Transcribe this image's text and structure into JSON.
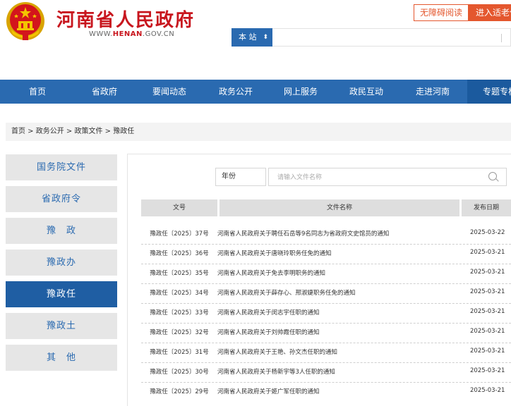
{
  "header": {
    "site_title": "河南省人民政府",
    "site_url_prefix": "WWW.",
    "site_url_highlight": "HENAN",
    "site_url_suffix": ".GOV.CN",
    "accessibility_label": "无障碍阅读",
    "elder_mode_label": "进入适老化",
    "search_scope_label": "本 站",
    "brand_color": "#c8161e",
    "accent_color": "#2a6ab0"
  },
  "nav": {
    "items": [
      {
        "label": "首页"
      },
      {
        "label": "省政府"
      },
      {
        "label": "要闻动态"
      },
      {
        "label": "政务公开"
      },
      {
        "label": "网上服务"
      },
      {
        "label": "政民互动"
      },
      {
        "label": "走进河南"
      },
      {
        "label": "专题专栏"
      }
    ],
    "active_index": 7
  },
  "breadcrumb": "首页 > 政务公开 > 政策文件 > 豫政任",
  "sidebar": {
    "items": [
      {
        "label": "国务院文件"
      },
      {
        "label": "省政府令"
      },
      {
        "label": "豫　政"
      },
      {
        "label": "豫政办"
      },
      {
        "label": "豫政任"
      },
      {
        "label": "豫政土"
      },
      {
        "label": "其　他"
      }
    ],
    "active_index": 4
  },
  "filter": {
    "year_label": "年份",
    "name_placeholder": "请输入文件名称"
  },
  "table": {
    "headers": {
      "no": "文号",
      "title": "文件名称",
      "date": "发布日期"
    },
    "rows": [
      {
        "no": "豫政任〔2025〕37号",
        "title": "河南省人民政府关于聘任石岳等9名同志为省政府文史馆员的通知",
        "date": "2025-03-22"
      },
      {
        "no": "豫政任〔2025〕36号",
        "title": "河南省人民政府关于唐晓玲职务任免的通知",
        "date": "2025-03-21"
      },
      {
        "no": "豫政任〔2025〕35号",
        "title": "河南省人民政府关于免去李明职务的通知",
        "date": "2025-03-21"
      },
      {
        "no": "豫政任〔2025〕34号",
        "title": "河南省人民政府关于薛存心、邢淑婕职务任免的通知",
        "date": "2025-03-21"
      },
      {
        "no": "豫政任〔2025〕33号",
        "title": "河南省人民政府关于闵志宇任职的通知",
        "date": "2025-03-21"
      },
      {
        "no": "豫政任〔2025〕32号",
        "title": "河南省人民政府关于刘帅霞任职的通知",
        "date": "2025-03-21"
      },
      {
        "no": "豫政任〔2025〕31号",
        "title": "河南省人民政府关于王艳、孙文杰任职的通知",
        "date": "2025-03-21"
      },
      {
        "no": "豫政任〔2025〕30号",
        "title": "河南省人民政府关于杨新宇等3人任职的通知",
        "date": "2025-03-21"
      },
      {
        "no": "豫政任〔2025〕29号",
        "title": "河南省人民政府关于姬广军任职的通知",
        "date": "2025-03-21"
      }
    ]
  }
}
